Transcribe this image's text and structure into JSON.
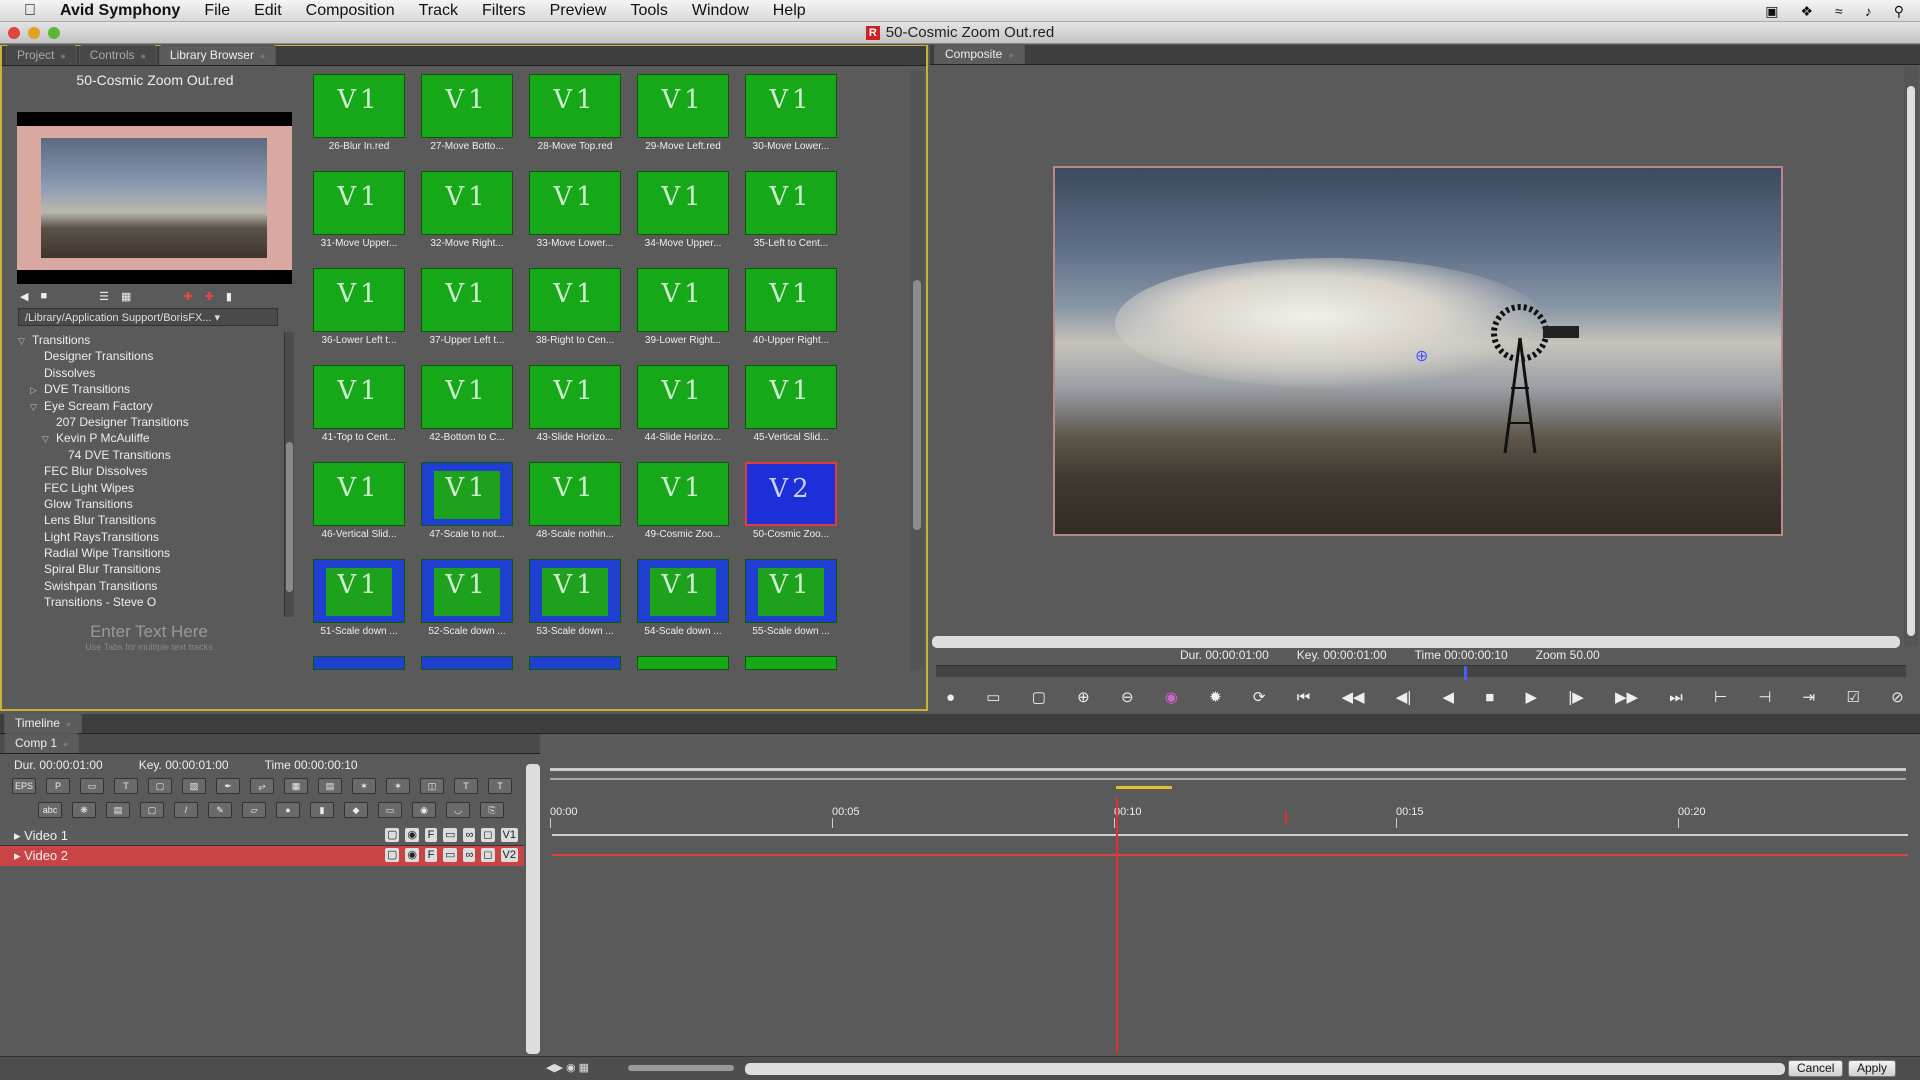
{
  "menubar": {
    "app": "Avid Symphony",
    "items": [
      "File",
      "Edit",
      "Composition",
      "Track",
      "Filters",
      "Preview",
      "Tools",
      "Window",
      "Help"
    ]
  },
  "window": {
    "title": "50-Cosmic Zoom Out.red"
  },
  "left_tabs": [
    "Project",
    "Controls",
    "Library Browser"
  ],
  "library": {
    "preset_name": "50-Cosmic Zoom Out.red",
    "path": "/Library/Application Support/BorisFX...",
    "tree": [
      {
        "label": "Transitions",
        "indent": 1,
        "arrow": "▽"
      },
      {
        "label": "Designer Transitions",
        "indent": 2,
        "arrow": ""
      },
      {
        "label": "Dissolves",
        "indent": 2,
        "arrow": ""
      },
      {
        "label": "DVE Transitions",
        "indent": 2,
        "arrow": "▷"
      },
      {
        "label": "Eye Scream Factory",
        "indent": 2,
        "arrow": "▽"
      },
      {
        "label": "207 Designer Transitions",
        "indent": 3,
        "arrow": ""
      },
      {
        "label": "Kevin P McAuliffe",
        "indent": 3,
        "arrow": "▽"
      },
      {
        "label": "74 DVE Transitions",
        "indent": 4,
        "arrow": ""
      },
      {
        "label": "FEC Blur Dissolves",
        "indent": 2,
        "arrow": ""
      },
      {
        "label": "FEC Light Wipes",
        "indent": 2,
        "arrow": ""
      },
      {
        "label": "Glow Transitions",
        "indent": 2,
        "arrow": ""
      },
      {
        "label": "Lens Blur Transitions",
        "indent": 2,
        "arrow": ""
      },
      {
        "label": "Light RaysTransitions",
        "indent": 2,
        "arrow": ""
      },
      {
        "label": "Radial Wipe Transitions",
        "indent": 2,
        "arrow": ""
      },
      {
        "label": "Spiral Blur Transitions",
        "indent": 2,
        "arrow": ""
      },
      {
        "label": "Swishpan Transitions",
        "indent": 2,
        "arrow": ""
      },
      {
        "label": "Transitions - Steve O",
        "indent": 2,
        "arrow": ""
      }
    ],
    "enter_text": "Enter Text Here",
    "enter_hint": "Use Tabs for multiple text tracks"
  },
  "presets": [
    {
      "cap": "26-Blur In.red",
      "label": "V1",
      "style": "green"
    },
    {
      "cap": "27-Move Botto...",
      "label": "V1",
      "style": "green"
    },
    {
      "cap": "28-Move Top.red",
      "label": "V1",
      "style": "green"
    },
    {
      "cap": "29-Move Left.red",
      "label": "V1",
      "style": "green"
    },
    {
      "cap": "30-Move Lower...",
      "label": "V1",
      "style": "green"
    },
    {
      "cap": "31-Move Upper...",
      "label": "V1",
      "style": "green"
    },
    {
      "cap": "32-Move Right...",
      "label": "V1",
      "style": "green"
    },
    {
      "cap": "33-Move Lower...",
      "label": "V1",
      "style": "green"
    },
    {
      "cap": "34-Move Upper...",
      "label": "V1",
      "style": "green"
    },
    {
      "cap": "35-Left to Cent...",
      "label": "V1",
      "style": "green"
    },
    {
      "cap": "36-Lower Left t...",
      "label": "V1",
      "style": "green"
    },
    {
      "cap": "37-Upper Left t...",
      "label": "V1",
      "style": "green"
    },
    {
      "cap": "38-Right to Cen...",
      "label": "V1",
      "style": "green"
    },
    {
      "cap": "39-Lower Right...",
      "label": "V1",
      "style": "green"
    },
    {
      "cap": "40-Upper Right...",
      "label": "V1",
      "style": "green"
    },
    {
      "cap": "41-Top to Cent...",
      "label": "V1",
      "style": "green"
    },
    {
      "cap": "42-Bottom to C...",
      "label": "V1",
      "style": "green"
    },
    {
      "cap": "43-Slide Horizo...",
      "label": "V1",
      "style": "green"
    },
    {
      "cap": "44-Slide Horizo...",
      "label": "V1",
      "style": "green"
    },
    {
      "cap": "45-Vertical Slid...",
      "label": "V1",
      "style": "green"
    },
    {
      "cap": "46-Vertical Slid...",
      "label": "V1",
      "style": "green"
    },
    {
      "cap": "47-Scale to not...",
      "label": "V1",
      "style": "blue"
    },
    {
      "cap": "48-Scale nothin...",
      "label": "V1",
      "style": "green"
    },
    {
      "cap": "49-Cosmic Zoo...",
      "label": "V1",
      "style": "green"
    },
    {
      "cap": "50-Cosmic Zoo...",
      "label": "V2",
      "style": "selected"
    },
    {
      "cap": "51-Scale down ...",
      "label": "V1",
      "style": "blue"
    },
    {
      "cap": "52-Scale down ...",
      "label": "V1",
      "style": "blue"
    },
    {
      "cap": "53-Scale down ...",
      "label": "V1",
      "style": "blue"
    },
    {
      "cap": "54-Scale down ...",
      "label": "V1",
      "style": "blue"
    },
    {
      "cap": "55-Scale down ...",
      "label": "V1",
      "style": "blue"
    }
  ],
  "composite": {
    "tab": "Composite",
    "dur_label": "Dur.",
    "dur": "00:00:01:00",
    "key_label": "Key.",
    "key": "00:00:01:00",
    "time_label": "Time",
    "time": "00:00:00:10",
    "zoom_label": "Zoom",
    "zoom": "50.00",
    "playhead_fraction": 0.55
  },
  "timeline": {
    "tab": "Timeline",
    "comp_tab": "Comp 1",
    "dur": "Dur.  00:00:01:00",
    "key": "Key.  00:00:01:00",
    "time": "Time 00:00:00:10",
    "ruler": [
      "00:00",
      "00:05",
      "00:10",
      "00:15",
      "00:20"
    ],
    "tracks": [
      {
        "name": "Video 1",
        "tag": "V1"
      },
      {
        "name": "Video 2",
        "tag": "V2"
      }
    ]
  },
  "buttons": {
    "cancel": "Cancel",
    "apply": "Apply"
  },
  "colors": {
    "preset_green": "#16a818",
    "preset_blue": "#1f3fd0",
    "selected_border": "#e23b3b",
    "playhead": "#e23030",
    "active_track": "#c94545",
    "panel_highlight": "#c8b23a"
  }
}
